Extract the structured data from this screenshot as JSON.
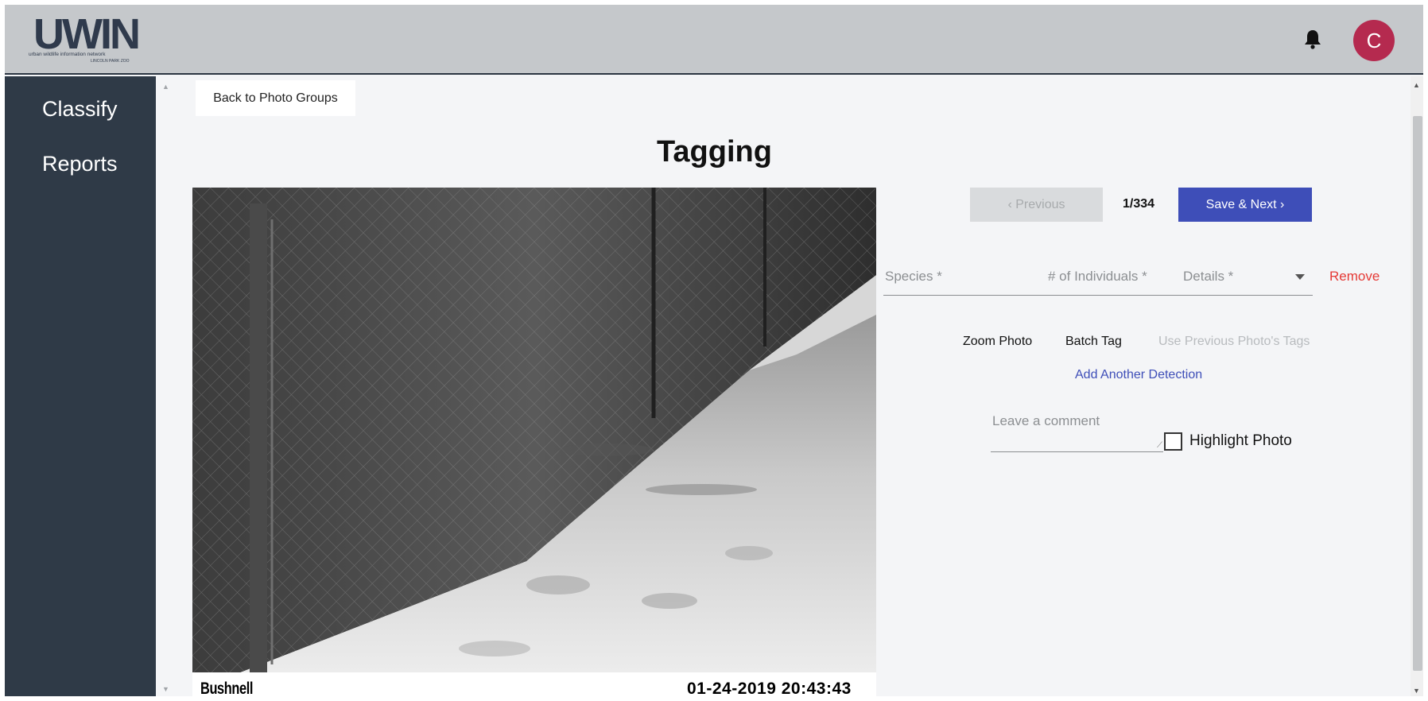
{
  "header": {
    "logo_text": "UWIN",
    "logo_subtitle": "urban wildlife information network",
    "logo_org": "LINCOLN PARK ZOO",
    "bell_icon": "bell-icon",
    "avatar_initial": "C",
    "avatar_color": "#b52a4f"
  },
  "sidebar": {
    "items": [
      {
        "label": "Classify"
      },
      {
        "label": "Reports"
      }
    ]
  },
  "main": {
    "back_label": "Back to Photo Groups",
    "title": "Tagging",
    "photo": {
      "brand": "Bushnell",
      "timestamp": "01-24-2019  20:43:43"
    }
  },
  "tagging": {
    "previous_label": "‹ Previous",
    "counter": "1/334",
    "next_label": "Save & Next ›",
    "species_placeholder": "Species *",
    "individuals_placeholder": "# of Individuals *",
    "details_placeholder": "Details *",
    "remove_label": "Remove",
    "zoom_label": "Zoom Photo",
    "batch_label": "Batch Tag",
    "use_previous_label": "Use Previous Photo's Tags",
    "add_detection_label": "Add Another Detection",
    "comment_placeholder": "Leave a comment",
    "highlight_label": "Highlight Photo"
  },
  "colors": {
    "accent": "#3e4eb8",
    "danger": "#e53935",
    "sidebar": "#2f3a47",
    "header": "#c5c8cb"
  }
}
